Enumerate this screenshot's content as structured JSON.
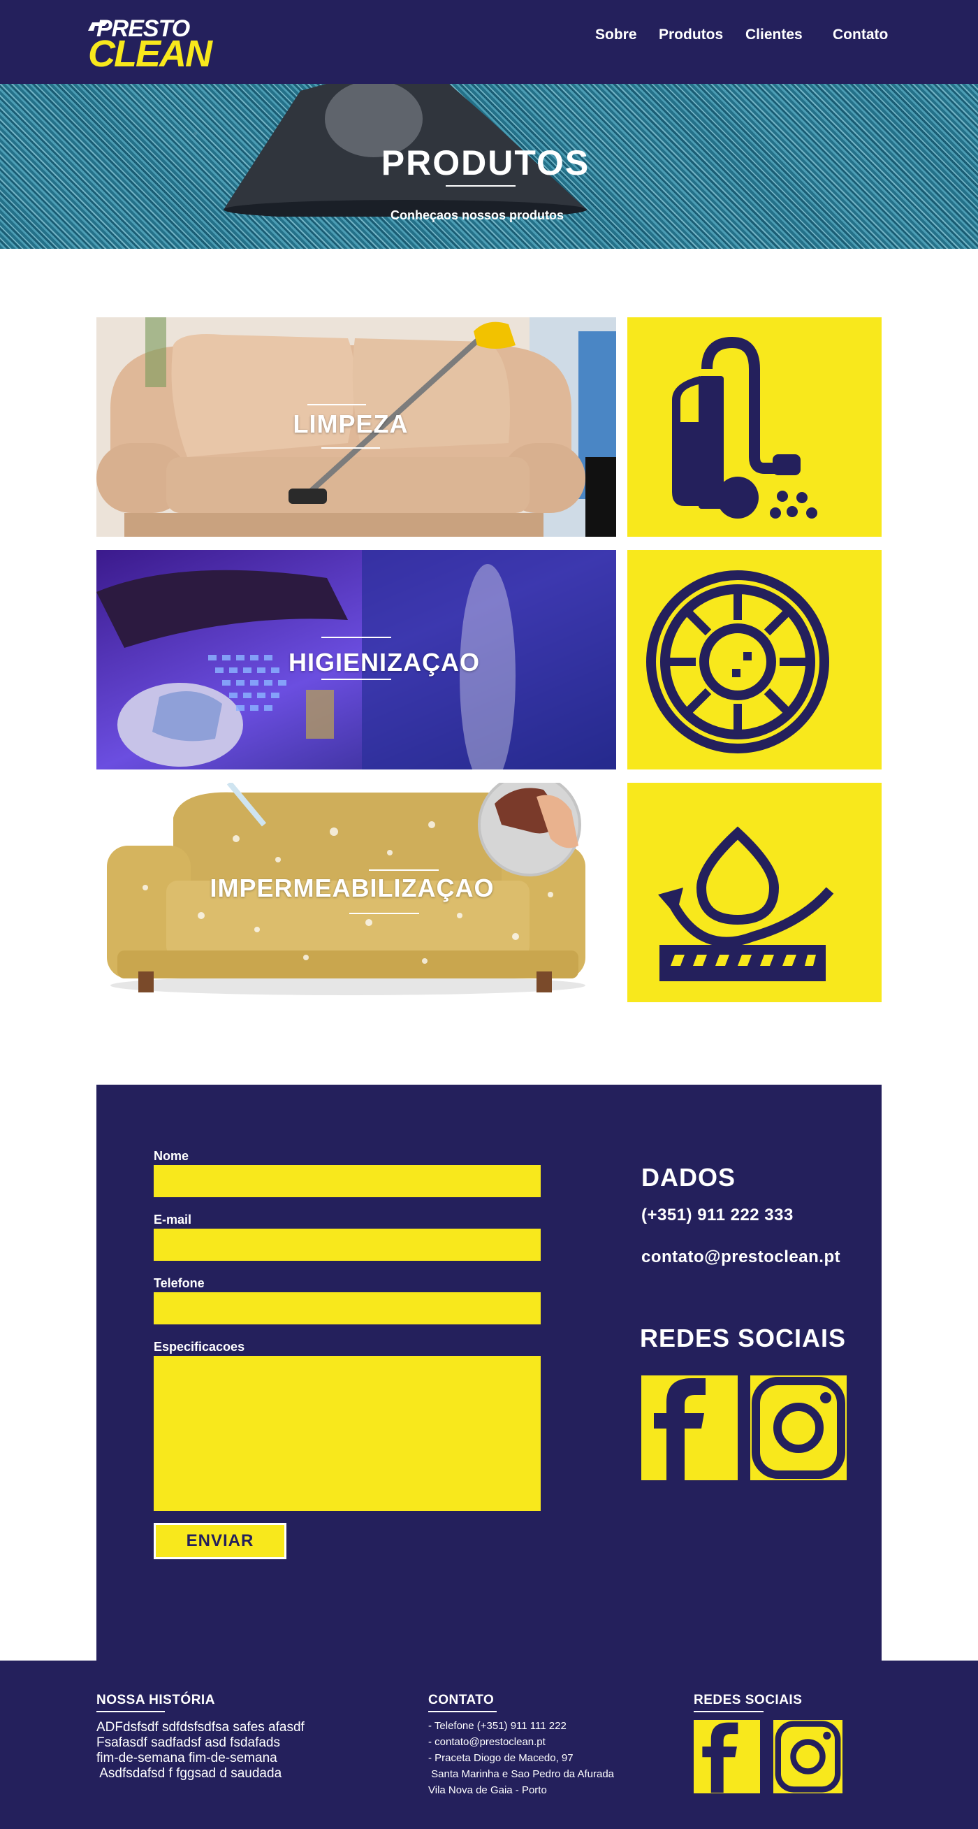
{
  "header": {
    "logo_top": "PRESTO",
    "logo_bottom": "CLEAN",
    "nav": [
      "Sobre",
      "Produtos",
      "Clientes",
      "Contato"
    ]
  },
  "hero": {
    "title": "PRODUTOS",
    "subtitle": "Conheçaos nossos produtos"
  },
  "products": [
    {
      "label": "LIMPEZA",
      "icon": "vacuum-cleaner-icon"
    },
    {
      "label": "HIGIENIZAÇAO",
      "icon": "virus-blocked-icon"
    },
    {
      "label": "IMPERMEABILIZAÇAO",
      "icon": "waterproof-fabric-icon"
    }
  ],
  "form": {
    "name_label": "Nome",
    "email_label": "E-mail",
    "phone_label": "Telefone",
    "spec_label": "Especificacoes",
    "send_label": "ENVIAR"
  },
  "info": {
    "dados_heading": "DADOS",
    "phone": "(+351) 911 222 333",
    "email": "contato@prestoclean.pt",
    "social_heading": "REDES SOCIAIS"
  },
  "footer": {
    "story_heading": "NOSSA HISTÓRIA",
    "story_lines": [
      "ADFdsfsdf sdfdsfsdfsa safes afasdf",
      "Fsafasdf sadfadsf asd fsdafads",
      "fim-de-semana fim-de-semana",
      " Asdfsdafsd f fggsad d saudada"
    ],
    "contact_heading": "CONTATO",
    "contact_lines": [
      "- Telefone (+351) 911 111 222",
      "- contato@prestoclean.pt",
      "- Praceta Diogo de Macedo, 97",
      " Santa Marinha e Sao Pedro da Afurada",
      "Vila Nova de Gaia - Porto"
    ],
    "social_heading": "REDES SOCIAIS"
  },
  "colors": {
    "navy": "#24205c",
    "yellow": "#f8e81c",
    "white": "#ffffff"
  }
}
